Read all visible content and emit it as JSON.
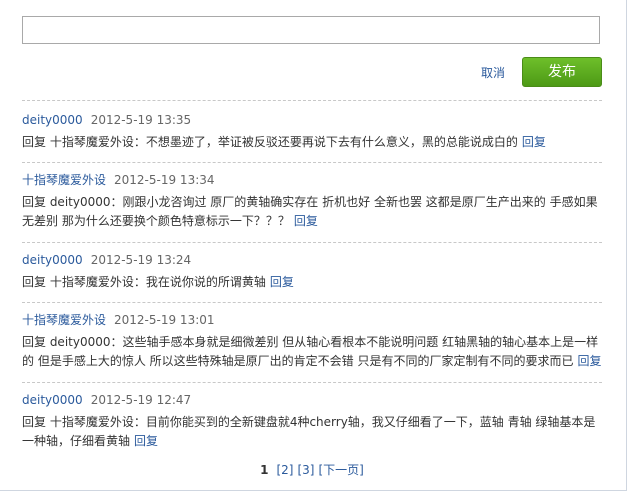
{
  "composer": {
    "input_value": "",
    "cancel_label": "取消",
    "publish_label": "发布"
  },
  "colors": {
    "link": "#2b5a9c",
    "publish_button": "#5aa81e"
  },
  "comments": [
    {
      "author": "deity0000",
      "time": "2012-5-19 13:35",
      "text": "回复 十指琴魔爱外设：不想墨迹了，举证被反驳还要再说下去有什么意义，黑的总能说成白的",
      "reply_label": "回复"
    },
    {
      "author": "十指琴魔爱外设",
      "time": "2012-5-19 13:34",
      "text": "回复 deity0000：刚跟小龙咨询过 原厂的黄轴确实存在 折机也好 全新也罢 这都是原厂生产出来的 手感如果无差别 那为什么还要换个颜色特意标示一下？？？",
      "reply_label": "回复"
    },
    {
      "author": "deity0000",
      "time": "2012-5-19 13:24",
      "text": "回复 十指琴魔爱外设：我在说你说的所谓黄轴",
      "reply_label": "回复"
    },
    {
      "author": "十指琴魔爱外设",
      "time": "2012-5-19 13:01",
      "text": "回复 deity0000：这些轴手感本身就是细微差别 但从轴心看根本不能说明问题 红轴黑轴的轴心基本上是一样的 但是手感上大的惊人 所以这些特殊轴是原厂出的肯定不会错 只是有不同的厂家定制有不同的要求而已",
      "reply_label": "回复"
    },
    {
      "author": "deity0000",
      "time": "2012-5-19 12:47",
      "text": "回复 十指琴魔爱外设：目前你能买到的全新键盘就4种cherry轴，我又仔细看了一下，蓝轴 青轴 绿轴基本是一种轴，仔细看黄轴",
      "reply_label": "回复"
    }
  ],
  "pagination": {
    "current": "1",
    "page2": "[2]",
    "page3": "[3]",
    "next": "[下一页]"
  }
}
